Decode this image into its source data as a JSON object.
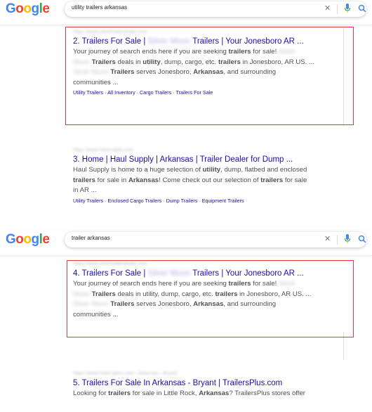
{
  "panels": [
    {
      "logo": "Google",
      "query": "utility trailers arkansas",
      "results": [
        {
          "url": "https://www.silvertrailerdealer.com",
          "title_parts": [
            "2. Trailers For Sale | ",
            "Silver Moon",
            " Trailers | Your Jonesboro AR ..."
          ],
          "snippet_lines": [
            [
              "Your journey of search ends here if you are seeking ",
              {
                "b": "trailers"
              },
              " for sale! ",
              {
                "blur": "Silver"
              }
            ],
            [
              {
                "blur": "Moon"
              },
              " ",
              {
                "b": "Trailers"
              },
              " deals in ",
              {
                "b": "utility"
              },
              ", dump, cargo, etc. ",
              {
                "b": "trailers"
              },
              " in Jonesboro, AR US. ..."
            ],
            [
              {
                "blur": "Silver Moon"
              },
              " ",
              {
                "b": "Trailers"
              },
              " serves Jonesboro, ",
              {
                "b": "Arkansas"
              },
              ", and surrounding"
            ],
            [
              "communities ..."
            ]
          ],
          "sitelinks": "Utility Trailers · All Inventory · Cargo Trailers · Trailers For Sale"
        },
        {
          "url": "https://www.haulsupply.com",
          "title_parts": [
            "3. Home | Haul Supply | Arkansas | Trailer Dealer for Dump ..."
          ],
          "snippet_lines": [
            [
              "Haul Supply is home to a huge selection of ",
              {
                "b": "utility"
              },
              ", dump, flatbed and enclosed"
            ],
            [
              {
                "b": "trailers"
              },
              " for sale in ",
              {
                "b": "Arkansas"
              },
              "! Come check out our selection of ",
              {
                "b": "trailers"
              },
              " for sale"
            ],
            [
              "in AR ..."
            ]
          ],
          "sitelinks": "Utility Trailers · Enclosed Cargo Trailers · Dump Trailers · Equipment Trailers"
        }
      ]
    },
    {
      "logo": "Google",
      "query": "trailer arkansas",
      "results": [
        {
          "url": "https://www.silvertrailerdealer.com",
          "title_parts": [
            "4. Trailers For Sale | ",
            "Silver Moon",
            " Trailers | Your Jonesboro AR ..."
          ],
          "snippet_lines": [
            [
              "Your journey of search ends here if you are seeking ",
              {
                "b": "trailers"
              },
              " for sale! ",
              {
                "blur": "Silver"
              }
            ],
            [
              {
                "blur": "Moon"
              },
              " ",
              {
                "b": "Trailers"
              },
              " deals in utility, dump, cargo, etc. ",
              {
                "b": "trailers"
              },
              " in Jonesboro, AR US. ..."
            ],
            [
              {
                "blur": "Silver Moon"
              },
              " ",
              {
                "b": "Trailers"
              },
              " serves Jonesboro, ",
              {
                "b": "Arkansas"
              },
              ", and surrounding"
            ],
            [
              "communities ..."
            ]
          ],
          "sitelinks": ""
        },
        {
          "url": "https://www.trailersplus.com › Arkansas › Bryant",
          "title_parts": [
            "5. Trailers For Sale In Arkansas - Bryant | TrailersPlus.com"
          ],
          "snippet_lines": [
            [
              "Looking for ",
              {
                "b": "trailers"
              },
              " for sale in Little Rock, ",
              {
                "b": "Arkansas"
              },
              "? TrailersPlus stores offer"
            ]
          ],
          "sitelinks": ""
        }
      ]
    }
  ],
  "colors": {
    "highlight": "#e8363b",
    "link": "#1a0dab"
  }
}
